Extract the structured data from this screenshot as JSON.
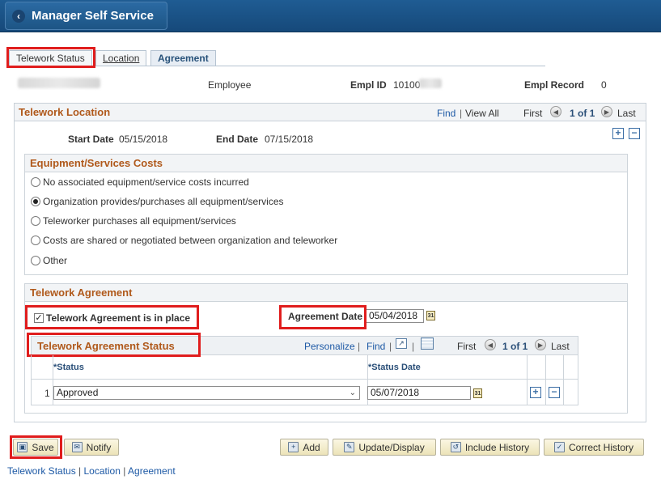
{
  "header": {
    "back_label": "Manager Self Service"
  },
  "tabs": [
    {
      "label": "Telework Status"
    },
    {
      "label": "Location"
    },
    {
      "label": "Agreement"
    }
  ],
  "employee": {
    "type": "Employee",
    "empl_id_label": "Empl ID",
    "empl_id_value": "10100",
    "empl_record_label": "Empl Record",
    "empl_record_value": "0"
  },
  "location": {
    "title": "Telework Location",
    "find": "Find",
    "view_all": "View All",
    "first": "First",
    "count": "1 of 1",
    "last": "Last",
    "start_date_label": "Start Date",
    "start_date": "05/15/2018",
    "end_date_label": "End Date",
    "end_date": "07/15/2018"
  },
  "costs": {
    "title": "Equipment/Services Costs",
    "options": [
      {
        "label": "No associated equipment/service costs incurred",
        "selected": false
      },
      {
        "label": "Organization provides/purchases all equipment/services",
        "selected": true
      },
      {
        "label": "Teleworker purchases all equipment/services",
        "selected": false
      },
      {
        "label": "Costs are shared or negotiated between organization and teleworker",
        "selected": false
      },
      {
        "label": "Other",
        "selected": false
      }
    ]
  },
  "agreement": {
    "title": "Telework Agreement",
    "in_place_label": "Telework Agreement is in place",
    "in_place_checked": true,
    "date_label": "Agreement Date",
    "date_value": "05/04/2018"
  },
  "status_grid": {
    "title": "Telework Agreement Status",
    "personalize": "Personalize",
    "find": "Find",
    "first": "First",
    "count": "1 of 1",
    "last": "Last",
    "col_status": "*Status",
    "col_status_date": "*Status Date",
    "rows": [
      {
        "num": "1",
        "status": "Approved",
        "status_date": "05/07/2018"
      }
    ]
  },
  "buttons": {
    "save": "Save",
    "notify": "Notify",
    "add": "Add",
    "update_display": "Update/Display",
    "include_history": "Include History",
    "correct_history": "Correct History"
  },
  "footer_links": [
    "Telework Status",
    "Location",
    "Agreement"
  ],
  "colors": {
    "header_blue": "#1f5c93",
    "section_orange": "#b0591b",
    "highlight_red": "#e01d1d",
    "link_blue": "#1d59a5"
  }
}
